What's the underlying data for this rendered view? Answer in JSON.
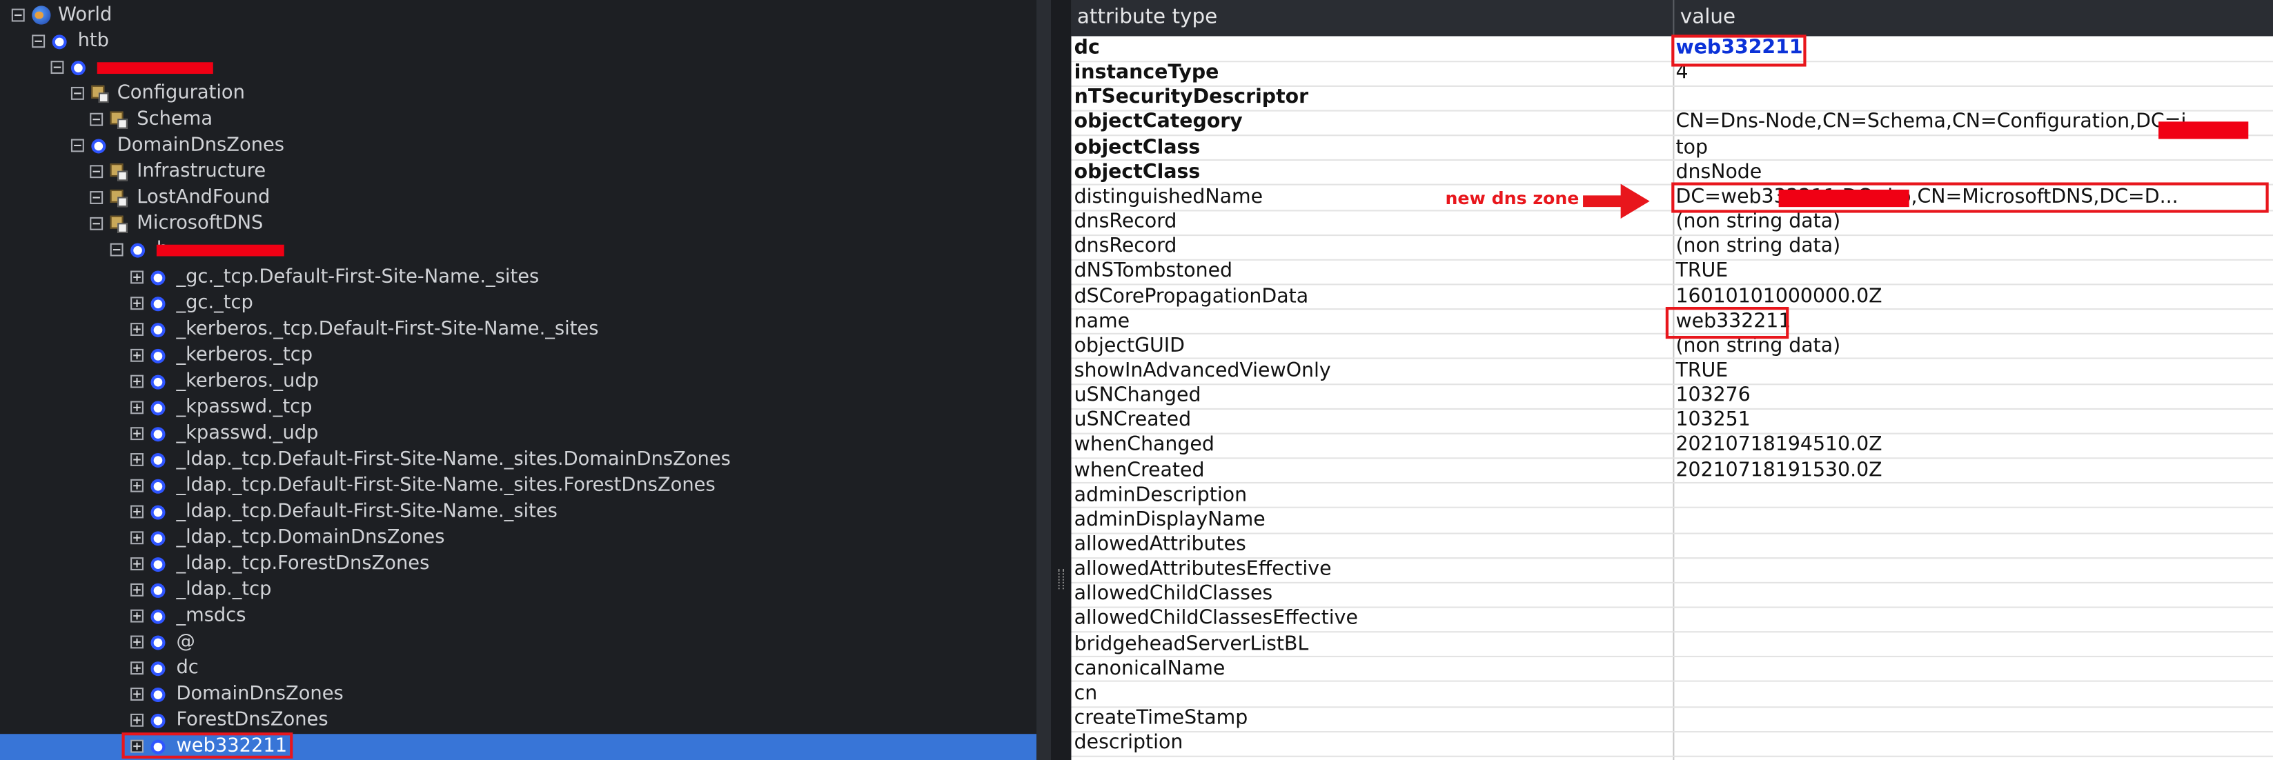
{
  "tree": {
    "nodes": [
      {
        "label": "World",
        "icon": "globe-icon",
        "indent": 0
      },
      {
        "label": "htb",
        "icon": "circle-icon",
        "indent": 1
      },
      {
        "label": "",
        "icon": "circle-icon",
        "indent": 2,
        "redacted": true
      },
      {
        "label": "Configuration",
        "icon": "folder-icon",
        "indent": 3
      },
      {
        "label": "Schema",
        "icon": "folder-icon",
        "indent": 4
      },
      {
        "label": "DomainDnsZones",
        "icon": "circle-icon",
        "indent": 3
      },
      {
        "label": "Infrastructure",
        "icon": "folder-icon",
        "indent": 4
      },
      {
        "label": "LostAndFound",
        "icon": "folder-icon",
        "indent": 4
      },
      {
        "label": "MicrosoftDNS",
        "icon": "folder-icon",
        "indent": 4
      },
      {
        "label": "b",
        "icon": "circle-icon",
        "indent": 5,
        "redacted": true
      },
      {
        "label": "_gc._tcp.Default-First-Site-Name._sites",
        "icon": "circle-icon",
        "indent": 6
      },
      {
        "label": "_gc._tcp",
        "icon": "circle-icon",
        "indent": 6
      },
      {
        "label": "_kerberos._tcp.Default-First-Site-Name._sites",
        "icon": "circle-icon",
        "indent": 6
      },
      {
        "label": "_kerberos._tcp",
        "icon": "circle-icon",
        "indent": 6
      },
      {
        "label": "_kerberos._udp",
        "icon": "circle-icon",
        "indent": 6
      },
      {
        "label": "_kpasswd._tcp",
        "icon": "circle-icon",
        "indent": 6
      },
      {
        "label": "_kpasswd._udp",
        "icon": "circle-icon",
        "indent": 6
      },
      {
        "label": "_ldap._tcp.Default-First-Site-Name._sites.DomainDnsZones",
        "icon": "circle-icon",
        "indent": 6
      },
      {
        "label": "_ldap._tcp.Default-First-Site-Name._sites.ForestDnsZones",
        "icon": "circle-icon",
        "indent": 6
      },
      {
        "label": "_ldap._tcp.Default-First-Site-Name._sites",
        "icon": "circle-icon",
        "indent": 6
      },
      {
        "label": "_ldap._tcp.DomainDnsZones",
        "icon": "circle-icon",
        "indent": 6
      },
      {
        "label": "_ldap._tcp.ForestDnsZones",
        "icon": "circle-icon",
        "indent": 6
      },
      {
        "label": "_ldap._tcp",
        "icon": "circle-icon",
        "indent": 6
      },
      {
        "label": "_msdcs",
        "icon": "circle-icon",
        "indent": 6
      },
      {
        "label": "@",
        "icon": "circle-icon",
        "indent": 6
      },
      {
        "label": "dc",
        "icon": "circle-icon",
        "indent": 6
      },
      {
        "label": "DomainDnsZones",
        "icon": "circle-icon",
        "indent": 6
      },
      {
        "label": "ForestDnsZones",
        "icon": "circle-icon",
        "indent": 6
      },
      {
        "label": "web332211",
        "icon": "circle-icon",
        "indent": 6,
        "selected": true
      }
    ]
  },
  "table": {
    "headers": [
      "attribute type",
      "value"
    ],
    "rows": [
      {
        "attr": "dc",
        "value": "web332211",
        "bold": true,
        "link": true
      },
      {
        "attr": "instanceType",
        "value": "4",
        "bold": true
      },
      {
        "attr": "nTSecurityDescriptor",
        "value": "",
        "bold": true
      },
      {
        "attr": "objectCategory",
        "value": "CN=Dns-Node,CN=Schema,CN=Configuration,DC=i...",
        "bold": true
      },
      {
        "attr": "objectClass",
        "value": "top",
        "bold": true
      },
      {
        "attr": "objectClass",
        "value": "dnsNode",
        "bold": true
      },
      {
        "attr": "distinguishedName",
        "value": "DC=web332211,DC=i                o,CN=MicrosoftDNS,DC=D..."
      },
      {
        "attr": "dnsRecord",
        "value": "(non string data)"
      },
      {
        "attr": "dnsRecord",
        "value": "(non string data)"
      },
      {
        "attr": "dNSTombstoned",
        "value": "TRUE"
      },
      {
        "attr": "dSCorePropagationData",
        "value": "16010101000000.0Z"
      },
      {
        "attr": "name",
        "value": "web332211"
      },
      {
        "attr": "objectGUID",
        "value": "(non string data)"
      },
      {
        "attr": "showInAdvancedViewOnly",
        "value": "TRUE"
      },
      {
        "attr": "uSNChanged",
        "value": "103276"
      },
      {
        "attr": "uSNCreated",
        "value": "103251"
      },
      {
        "attr": "whenChanged",
        "value": "20210718194510.0Z"
      },
      {
        "attr": "whenCreated",
        "value": "20210718191530.0Z"
      },
      {
        "attr": "adminDescription",
        "value": ""
      },
      {
        "attr": "adminDisplayName",
        "value": ""
      },
      {
        "attr": "allowedAttributes",
        "value": ""
      },
      {
        "attr": "allowedAttributesEffective",
        "value": ""
      },
      {
        "attr": "allowedChildClasses",
        "value": ""
      },
      {
        "attr": "allowedChildClassesEffective",
        "value": ""
      },
      {
        "attr": "bridgeheadServerListBL",
        "value": ""
      },
      {
        "attr": "canonicalName",
        "value": ""
      },
      {
        "attr": "cn",
        "value": ""
      },
      {
        "attr": "createTimeStamp",
        "value": ""
      },
      {
        "attr": "description",
        "value": ""
      }
    ]
  },
  "annotation": {
    "text": "new dns zone",
    "color": "#e8161c"
  },
  "colors": {
    "selection": "#3875d7",
    "redaction": "#f00014",
    "link": "#0b32d8"
  }
}
